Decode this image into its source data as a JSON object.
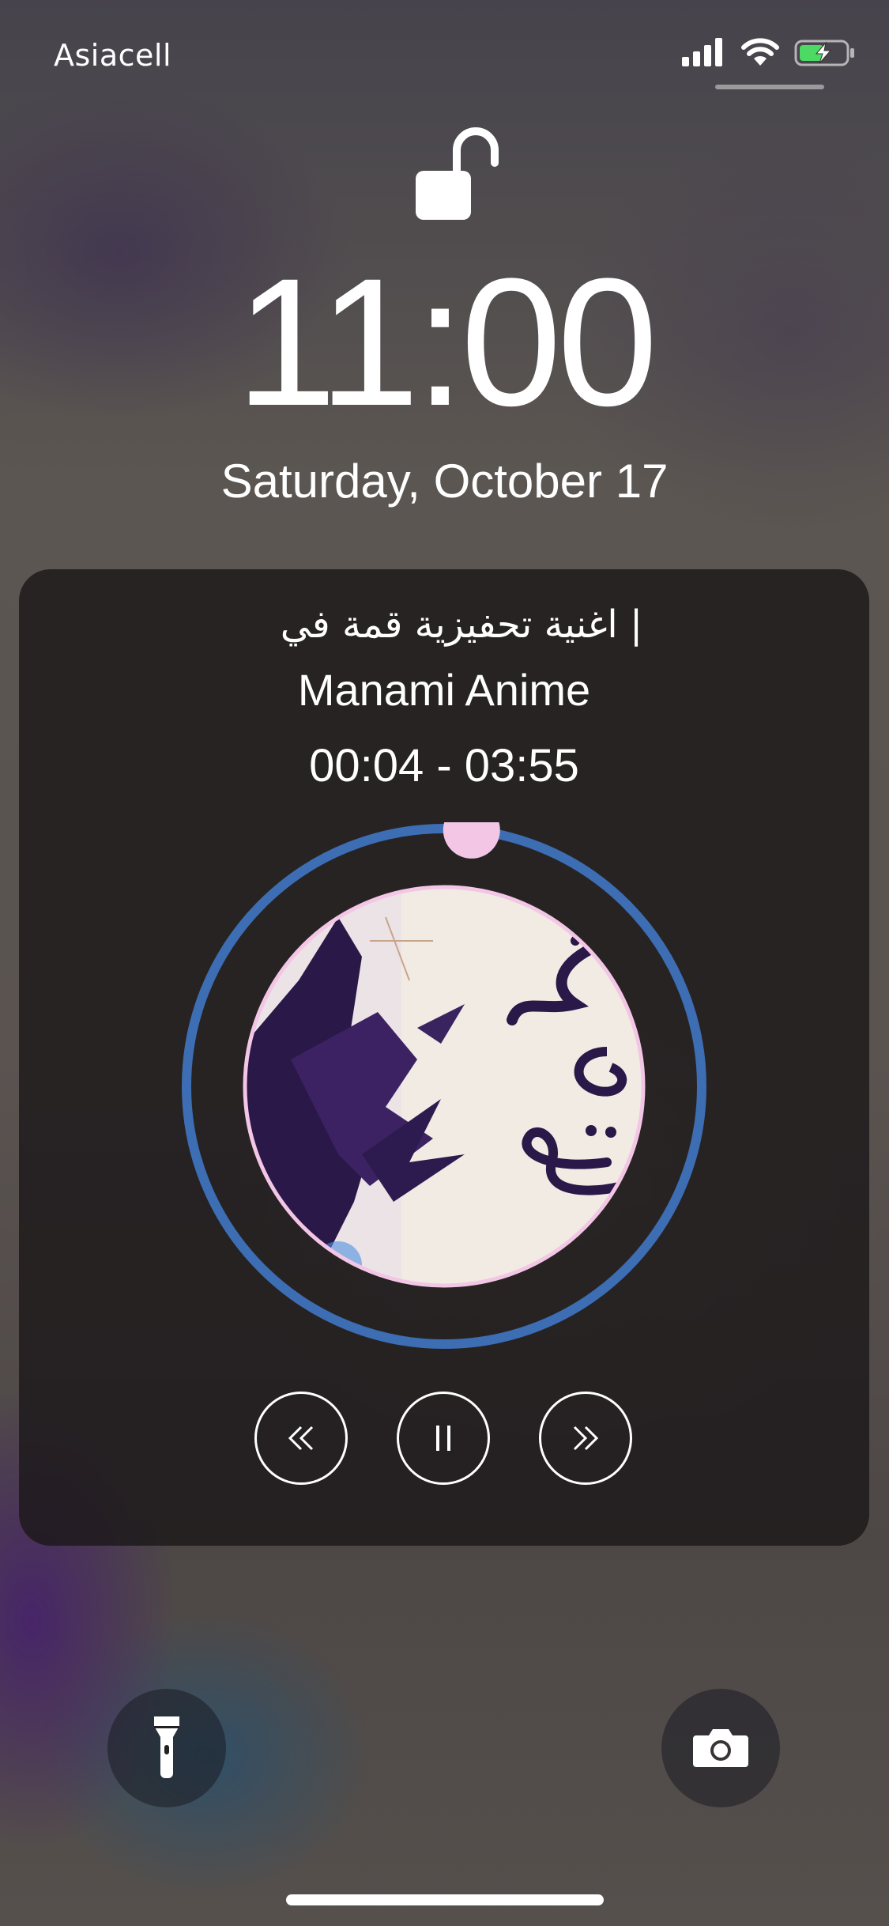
{
  "status_bar": {
    "carrier": "Asiacell",
    "icons": [
      "cellular-signal-icon",
      "wifi-icon",
      "battery-charging-icon"
    ],
    "battery_color": "#4cd964"
  },
  "lock_screen": {
    "lock_icon": "unlocked-padlock-icon",
    "time": "11:00",
    "date": "Saturday, October 17"
  },
  "now_playing": {
    "title": "| اغنية تحفيزية قمة في",
    "artist": "Manami Anime",
    "time_range": "00:04 - 03:55",
    "progress": 0.017,
    "ring_color": "#3d6db3",
    "knob_color": "#f3c6e6",
    "controls": {
      "previous_icon": "rewind-icon",
      "pause_icon": "pause-icon",
      "next_icon": "fast-forward-icon"
    }
  },
  "quick_actions": {
    "left": "flashlight-icon",
    "right": "camera-icon"
  }
}
